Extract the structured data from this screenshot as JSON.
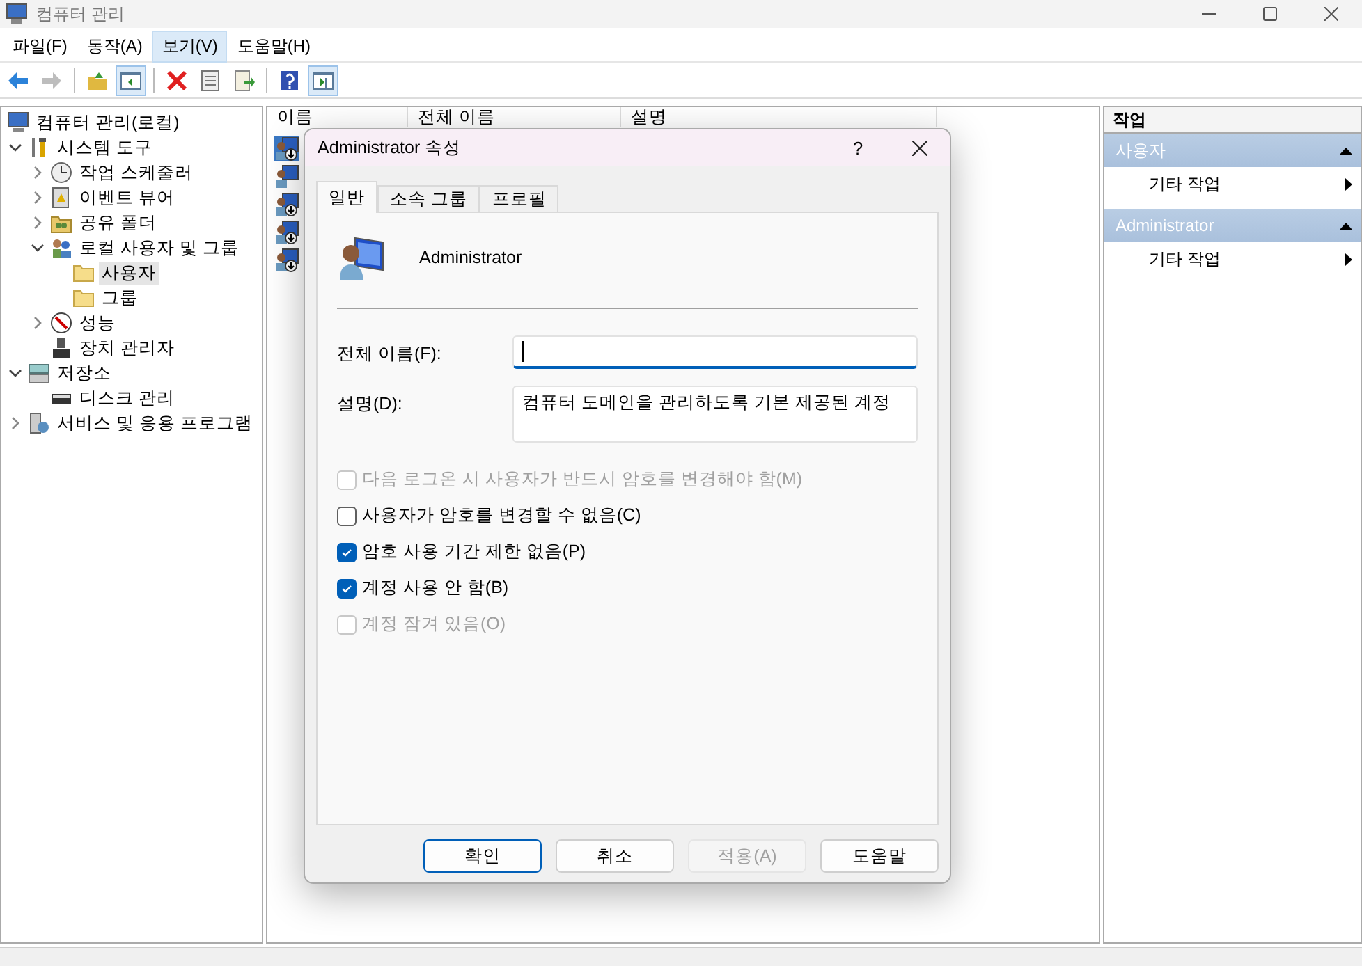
{
  "window": {
    "title": "컴퓨터 관리"
  },
  "menu": [
    {
      "label": "파일(F)",
      "selected": false
    },
    {
      "label": "동작(A)",
      "selected": false
    },
    {
      "label": "보기(V)",
      "selected": true
    },
    {
      "label": "도움말(H)",
      "selected": false
    }
  ],
  "toolbar": [
    {
      "kind": "back",
      "pressed": false,
      "disabled": false
    },
    {
      "kind": "forward",
      "pressed": false,
      "disabled": true
    },
    {
      "kind": "separator"
    },
    {
      "kind": "up",
      "pressed": false,
      "disabled": false
    },
    {
      "kind": "tree",
      "pressed": true,
      "disabled": false
    },
    {
      "kind": "separator"
    },
    {
      "kind": "delete",
      "pressed": false,
      "disabled": false
    },
    {
      "kind": "properties",
      "pressed": false,
      "disabled": false
    },
    {
      "kind": "export",
      "pressed": false,
      "disabled": false
    },
    {
      "kind": "separator"
    },
    {
      "kind": "help",
      "pressed": false,
      "disabled": false
    },
    {
      "kind": "pane",
      "pressed": true,
      "disabled": false
    }
  ],
  "tree": {
    "label": "컴퓨터 관리(로컬)",
    "kind": "computer",
    "children": [
      {
        "label": "시스템 도구",
        "kind": "tools",
        "expanded": true,
        "selected": false,
        "children": [
          {
            "label": "작업 스케줄러",
            "kind": "clock",
            "expanded": false,
            "selected": false
          },
          {
            "label": "이벤트 뷰어",
            "kind": "log",
            "expanded": false,
            "selected": false
          },
          {
            "label": "공유 폴더",
            "kind": "share",
            "expanded": false,
            "selected": false
          },
          {
            "label": "로컬 사용자 및 그룹",
            "kind": "users",
            "expanded": true,
            "selected": false,
            "children": [
              {
                "label": "사용자",
                "kind": "folder",
                "selected": true
              },
              {
                "label": "그룹",
                "kind": "folder",
                "selected": false
              }
            ]
          },
          {
            "label": "성능",
            "kind": "perf",
            "expanded": false,
            "selected": false
          },
          {
            "label": "장치 관리자",
            "kind": "device",
            "selected": false
          }
        ]
      },
      {
        "label": "저장소",
        "kind": "storage",
        "expanded": true,
        "selected": false,
        "children": [
          {
            "label": "디스크 관리",
            "kind": "disk",
            "selected": false
          }
        ]
      },
      {
        "label": "서비스 및 응용 프로그램",
        "kind": "services",
        "expanded": false,
        "selected": false
      }
    ]
  },
  "list": {
    "columns": [
      "이름",
      "전체 이름",
      "설명"
    ],
    "rows": [
      {
        "selected": true,
        "disabled": true
      },
      {
        "selected": false,
        "disabled": false
      },
      {
        "selected": false,
        "disabled": true
      },
      {
        "selected": false,
        "disabled": true
      },
      {
        "selected": false,
        "disabled": true
      }
    ]
  },
  "actions": {
    "title": "작업",
    "sections": [
      {
        "title": "사용자",
        "items": [
          "기타 작업"
        ]
      },
      {
        "title": "Administrator",
        "items": [
          "기타 작업"
        ]
      }
    ]
  },
  "dialog": {
    "title": "Administrator 속성",
    "help": "?",
    "tabs": [
      {
        "label": "일반",
        "selected": true
      },
      {
        "label": "소속 그룹",
        "selected": false
      },
      {
        "label": "프로필",
        "selected": false
      }
    ],
    "user_name": "Administrator",
    "fields": [
      {
        "label": "전체 이름(F):",
        "focused": true
      },
      {
        "label": "설명(D):",
        "value": "컴퓨터 도메인을 관리하도록 기본 제공된 계정",
        "focused": false
      }
    ],
    "checkboxes": [
      {
        "label": "다음 로그온 시 사용자가 반드시 암호를 변경해야 함(M)",
        "checked": false,
        "disabled": true
      },
      {
        "label": "사용자가 암호를 변경할 수 없음(C)",
        "checked": false,
        "disabled": false
      },
      {
        "label": "암호 사용 기간 제한 없음(P)",
        "checked": true,
        "disabled": false
      },
      {
        "label": "계정 사용 안 함(B)",
        "checked": true,
        "disabled": false
      },
      {
        "label": "계정 잠겨 있음(O)",
        "checked": false,
        "disabled": true
      }
    ],
    "buttons": [
      {
        "label": "확인",
        "default": true,
        "disabled": false
      },
      {
        "label": "취소",
        "default": false,
        "disabled": false
      },
      {
        "label": "적용(A)",
        "default": false,
        "disabled": true
      },
      {
        "label": "도움말",
        "default": false,
        "disabled": false
      }
    ]
  }
}
